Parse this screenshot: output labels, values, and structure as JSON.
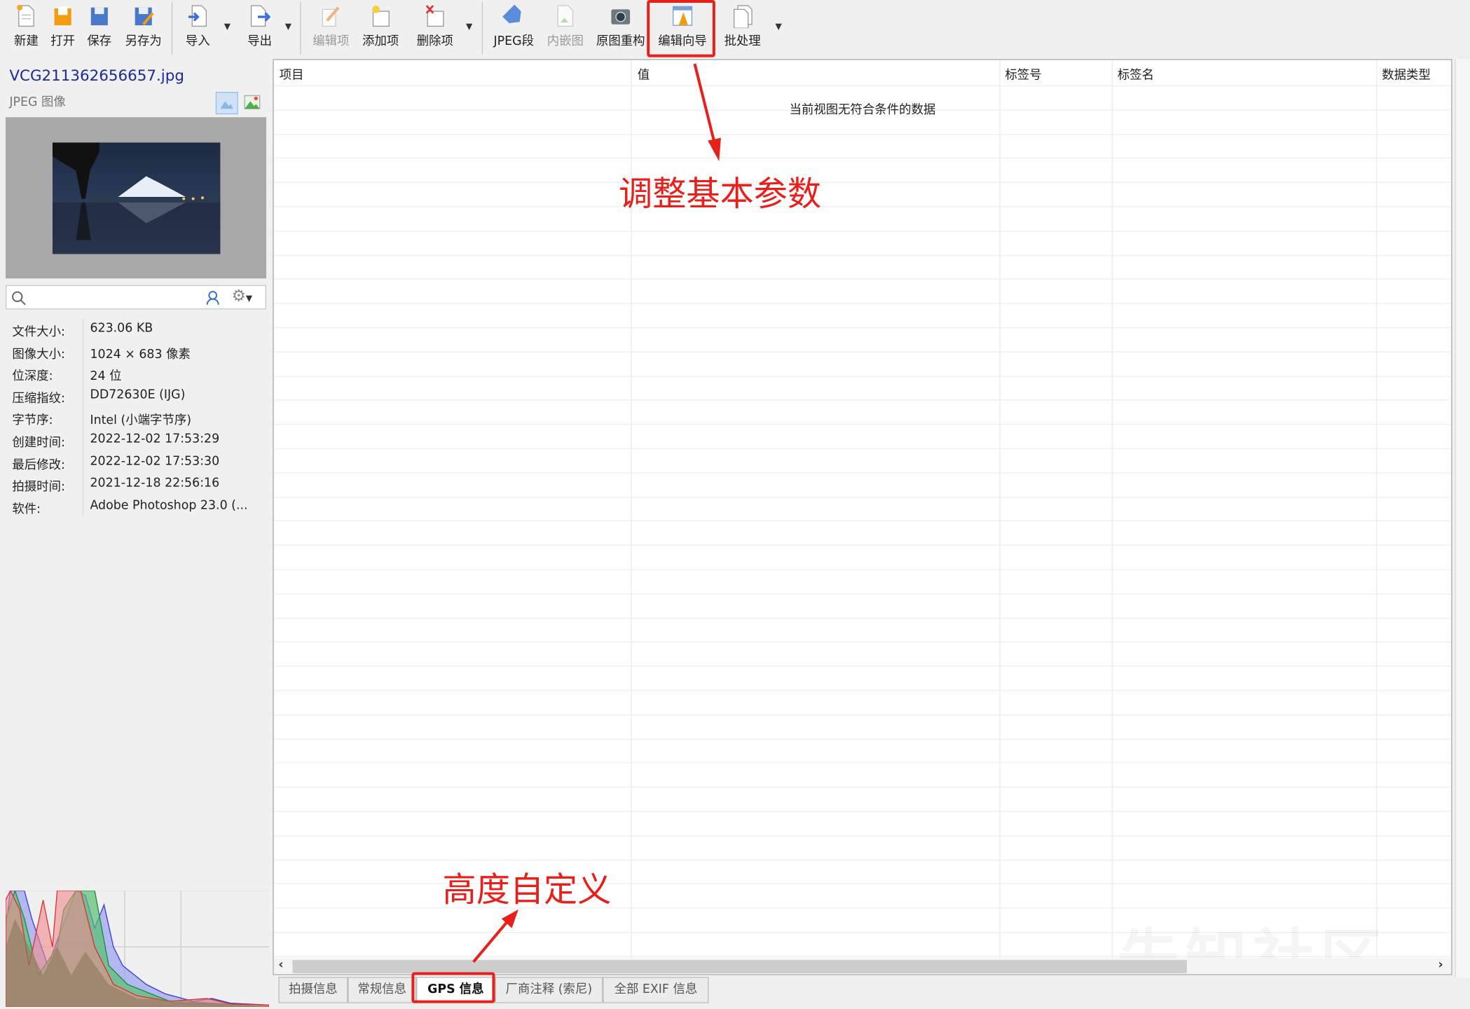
{
  "toolbar": {
    "buttons": [
      {
        "label": "新建",
        "icon": "new-file-icon",
        "enabled": true
      },
      {
        "label": "打开",
        "icon": "open-folder-icon",
        "enabled": true
      },
      {
        "label": "保存",
        "icon": "save-icon",
        "enabled": true
      },
      {
        "label": "另存为",
        "icon": "save-as-icon",
        "enabled": true
      },
      {
        "label": "导入",
        "icon": "import-icon",
        "enabled": true
      },
      {
        "label": "导出",
        "icon": "export-icon",
        "enabled": true
      },
      {
        "label": "编辑项",
        "icon": "edit-item-icon",
        "enabled": false
      },
      {
        "label": "添加项",
        "icon": "add-item-icon",
        "enabled": true
      },
      {
        "label": "删除项",
        "icon": "delete-item-icon",
        "enabled": true
      },
      {
        "label": "JPEG段",
        "icon": "tag-icon",
        "enabled": true
      },
      {
        "label": "内嵌图",
        "icon": "embedded-image-icon",
        "enabled": false
      },
      {
        "label": "原图重构",
        "icon": "camera-icon",
        "enabled": true
      },
      {
        "label": "编辑向导",
        "icon": "wizard-icon",
        "enabled": true
      },
      {
        "label": "批处理",
        "icon": "batch-icon",
        "enabled": true
      }
    ]
  },
  "file": {
    "name": "VCG211362656657.jpg",
    "type": "JPEG 图像"
  },
  "search": {
    "placeholder": "",
    "value": ""
  },
  "info": [
    {
      "key": "文件大小:",
      "value": "623.06 KB"
    },
    {
      "key": "图像大小:",
      "value": "1024 × 683 像素"
    },
    {
      "key": "位深度:",
      "value": "24 位"
    },
    {
      "key": "压缩指纹:",
      "value": "DD72630E (IJG)"
    },
    {
      "key": "字节序:",
      "value": "Intel (小端字节序)"
    },
    {
      "key": "创建时间:",
      "value": "2022-12-02 17:53:29"
    },
    {
      "key": "最后修改:",
      "value": "2022-12-02 17:53:30"
    },
    {
      "key": "拍摄时间:",
      "value": "2021-12-18 22:56:16"
    },
    {
      "key": "软件:",
      "value": "Adobe Photoshop 23.0 (..."
    }
  ],
  "table": {
    "columns": [
      "项目",
      "值",
      "标签号",
      "标签名",
      "数据类型"
    ],
    "empty_message": "当前视图无符合条件的数据"
  },
  "tabs": [
    {
      "label": "拍摄信息",
      "active": false
    },
    {
      "label": "常规信息",
      "active": false
    },
    {
      "label": "GPS 信息",
      "active": true
    },
    {
      "label": "厂商注释 (索尼)",
      "active": false
    },
    {
      "label": "全部 EXIF 信息",
      "active": false
    }
  ],
  "annotations": {
    "top": "调整基本参数",
    "bottom": "高度自定义",
    "color": "#e8201c"
  },
  "watermark": "先知社区"
}
